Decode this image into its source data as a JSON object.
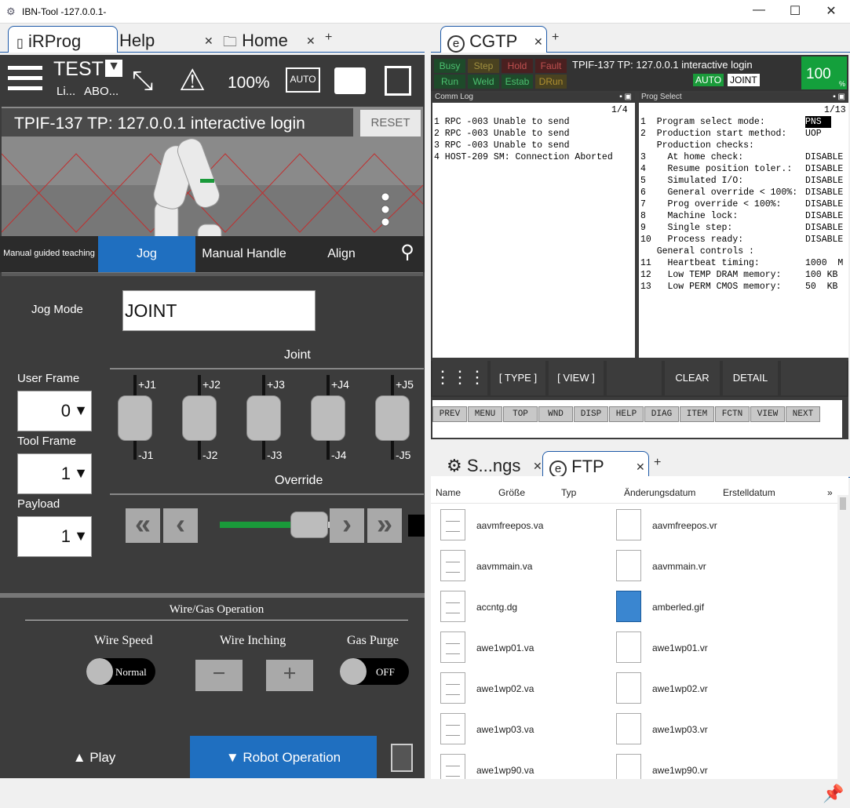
{
  "window": {
    "title": "IBN-Tool -127.0.0.1-"
  },
  "left_tabs": [
    {
      "label": "iRProg",
      "active": true
    },
    {
      "label": "Help",
      "active": false
    },
    {
      "label": "Home",
      "active": false
    }
  ],
  "right_top_tabs": [
    {
      "label": "CGTP",
      "active": true
    }
  ],
  "toolbar": {
    "program": "TEST",
    "line_short": "Li...",
    "abort_short": "ABO...",
    "override": "100%"
  },
  "view3d": {
    "title": "TPIF-137   TP: 127.0.0.1 interactive login",
    "reset": "RESET"
  },
  "jog_tabs": [
    {
      "label": "Manual guided teaching"
    },
    {
      "label": "Jog",
      "active": true
    },
    {
      "label": "Manual Handle"
    },
    {
      "label": "Align"
    }
  ],
  "jog": {
    "mode_label": "Jog Mode",
    "mode_value": "JOINT",
    "joint_title": "Joint",
    "user_frame_label": "User Frame",
    "user_frame_value": "0",
    "tool_frame_label": "Tool Frame",
    "tool_frame_value": "1",
    "payload_label": "Payload",
    "payload_value": "1",
    "override_title": "Override",
    "override_level": 0.45,
    "joints": [
      {
        "plus": "+J1",
        "minus": "-J1"
      },
      {
        "plus": "+J2",
        "minus": "-J2"
      },
      {
        "plus": "+J3",
        "minus": "-J3"
      },
      {
        "plus": "+J4",
        "minus": "-J4"
      },
      {
        "plus": "+J5",
        "minus": "-J5"
      }
    ]
  },
  "wire": {
    "title": "Wire/Gas Operation",
    "speed_label": "Wire Speed",
    "speed_value": "Normal",
    "inching_label": "Wire Inching",
    "gas_label": "Gas Purge",
    "gas_value": "OFF"
  },
  "bottom": {
    "play": "▲  Play",
    "robot_op": "▼  Robot Operation"
  },
  "cgtp": {
    "status_row1": [
      "Busy",
      "Step",
      "Hold",
      "Fault"
    ],
    "status_row2": [
      "Run",
      "Weld",
      "Estab",
      "DRun"
    ],
    "title": "TPIF-137 TP: 127.0.0.1 interactive login",
    "mode_auto": "AUTO",
    "mode_joint": "JOINT",
    "override": "100",
    "override_unit": "%",
    "commlog_title": "Comm Log",
    "commlog_page": "1/4",
    "commlog": [
      "1 RPC -003 Unable to send",
      "2 RPC -003 Unable to send",
      "3 RPC -003 Unable to send",
      "4 HOST-209 SM: Connection Aborted"
    ],
    "progselect_title": "Prog Select",
    "progselect_page": "1/13",
    "progselect": [
      {
        "text": "1  Program select mode:",
        "value": "PNS"
      },
      {
        "text": "2  Production start method:",
        "value": "UOP"
      },
      {
        "text": "   Production checks:",
        "value": ""
      },
      {
        "text": "3    At home check:",
        "value": "DISABLE"
      },
      {
        "text": "4    Resume position toler.:",
        "value": "DISABLE"
      },
      {
        "text": "5    Simulated I/O:",
        "value": "DISABLE"
      },
      {
        "text": "6    General override < 100%:",
        "value": "DISABLE"
      },
      {
        "text": "7    Prog override < 100%:",
        "value": "DISABLE"
      },
      {
        "text": "8    Machine lock:",
        "value": "DISABLE"
      },
      {
        "text": "9    Single step:",
        "value": "DISABLE"
      },
      {
        "text": "10   Process ready:",
        "value": "DISABLE"
      },
      {
        "text": "   General controls :",
        "value": ""
      },
      {
        "text": "11   Heartbeat timing:",
        "value": "1000  M"
      },
      {
        "text": "12   Low TEMP DRAM memory:",
        "value": "100 KB"
      },
      {
        "text": "13   Low PERM CMOS memory:",
        "value": "50  KB"
      }
    ],
    "softkeys": [
      "[ TYPE ]",
      "[ VIEW ]",
      "",
      "CLEAR",
      "DETAIL",
      ""
    ],
    "fkeys": [
      "PREV",
      "MENU",
      "TOP",
      "WND",
      "DISP",
      "HELP",
      "DIAG",
      "ITEM",
      "FCTN",
      "VIEW",
      "NEXT"
    ]
  },
  "bottom_tabs": [
    {
      "label": "S...ngs",
      "active": false
    },
    {
      "label": "FTP",
      "active": true
    }
  ],
  "ftp": {
    "headers": [
      "Name",
      "Größe",
      "Typ",
      "Änderungsdatum",
      "Erstelldatum"
    ],
    "files_left": [
      "aavmfreepos.va",
      "aavmmain.va",
      "accntg.dg",
      "awe1wp01.va",
      "awe1wp02.va",
      "awe1wp03.va",
      "awe1wp90.va"
    ],
    "files_right": [
      "aavmfreepos.vr",
      "aavmmain.vr",
      "amberled.gif",
      "awe1wp01.vr",
      "awe1wp02.vr",
      "awe1wp03.vr",
      "awe1wp90.vr"
    ]
  }
}
